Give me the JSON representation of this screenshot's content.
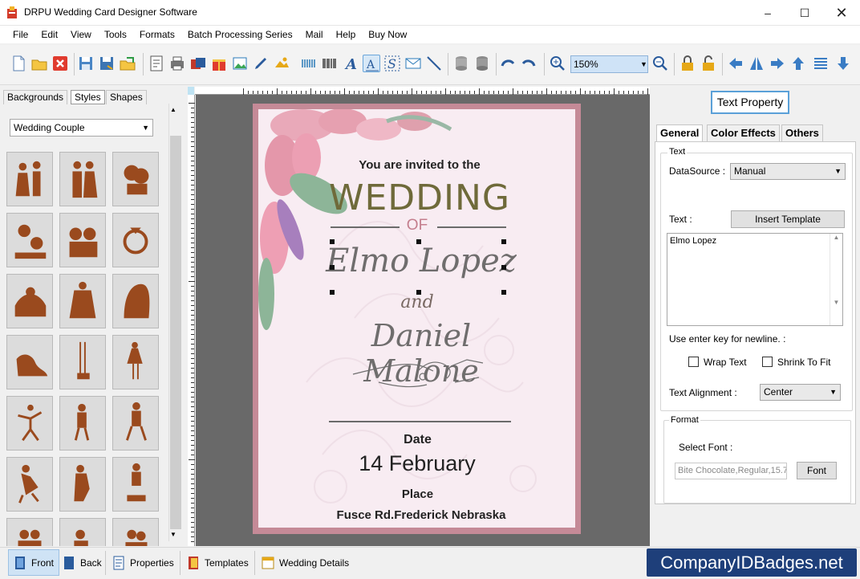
{
  "window": {
    "title": "DRPU Wedding Card Designer Software",
    "minimize_icon": "minimize-icon",
    "maximize_icon": "maximize-icon",
    "close_icon": "close-icon"
  },
  "menu": [
    "File",
    "Edit",
    "View",
    "Tools",
    "Formats",
    "Batch Processing Series",
    "Mail",
    "Help",
    "Buy Now"
  ],
  "toolbar": {
    "zoom_value": "150%"
  },
  "left_panel": {
    "tabs": [
      "Backgrounds",
      "Styles",
      "Shapes"
    ],
    "active_tab": "Styles",
    "category_select": "Wedding Couple"
  },
  "card": {
    "invite_line": "You are invited to the",
    "event_word": "WEDDING",
    "of_word": "OF",
    "name1": "Elmo Lopez",
    "and_word": "and",
    "name2": "Daniel Malone",
    "date_label": "Date",
    "date_value": "14 February",
    "place_label": "Place",
    "place_value": "Fusce Rd.Frederick Nebraska",
    "frame_color": "#c58a97",
    "background_color": "#f8ecf2"
  },
  "right_panel": {
    "title_button": "Text Property",
    "tabs": [
      "General",
      "Color Effects",
      "Others"
    ],
    "active_tab": "General",
    "text_group": "Text",
    "datasource_label": "DataSource :",
    "datasource_value": "Manual",
    "text_label": "Text :",
    "insert_template_button": "Insert Template",
    "text_value": "Elmo Lopez",
    "newline_hint": "Use enter key for newline. :",
    "wrap_text_label": "Wrap Text",
    "wrap_text_checked": false,
    "shrink_label": "Shrink To Fit",
    "shrink_checked": false,
    "alignment_label": "Text Alignment :",
    "alignment_value": "Center",
    "format_group": "Format",
    "select_font_label": "Select Font :",
    "font_value": "Bite Chocolate,Regular,15.7",
    "font_button": "Font"
  },
  "bottom_bar": {
    "tabs": [
      "Front",
      "Back",
      "Properties",
      "Templates",
      "Wedding Details"
    ],
    "active_tab": "Front",
    "brand": "CompanyIDBadges.net"
  }
}
